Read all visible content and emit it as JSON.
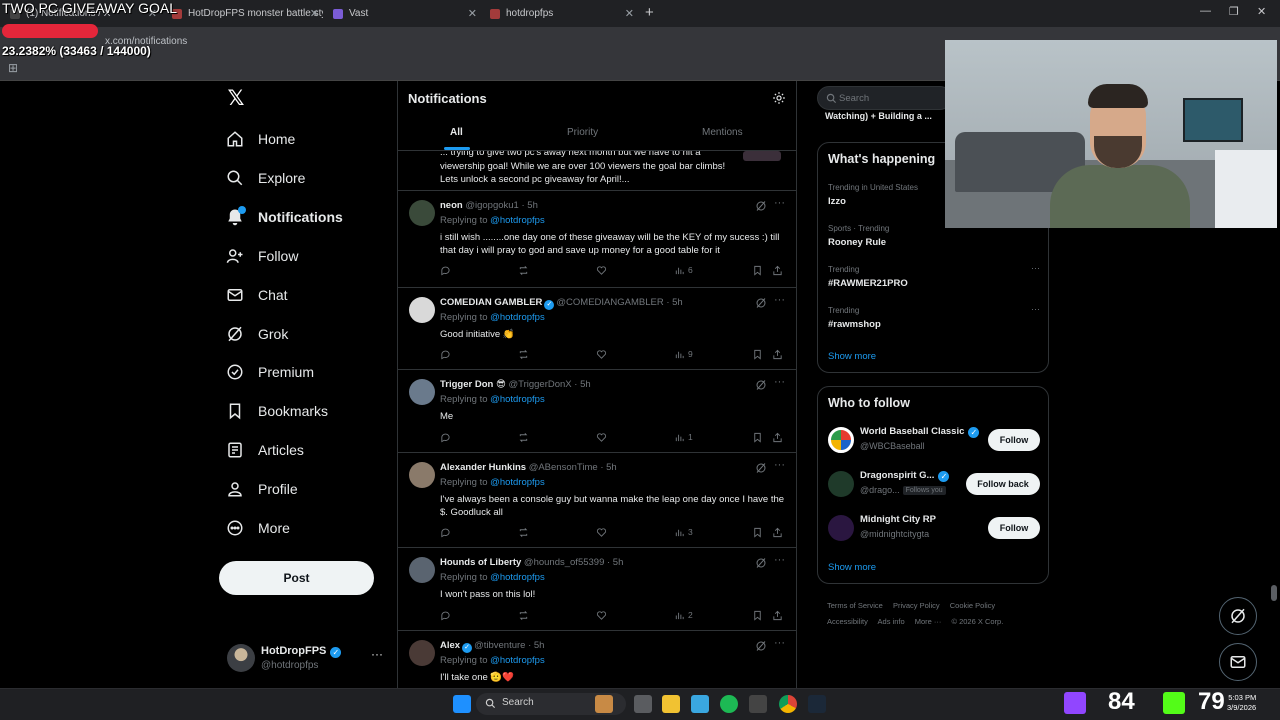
{
  "overlay": {
    "goal_title": "TWO PC GIVEAWAY GOAL",
    "progress_text": "23.2382% (33463 / 144000)",
    "progress_fraction": 0.232
  },
  "browser": {
    "tabs": [
      {
        "title": "(1) Notifications / X",
        "fav_color": "#444444"
      },
      {
        "title": "HotDropFPS monster battle style",
        "fav_color": "#a33b3b"
      },
      {
        "title": "Vast",
        "fav_color": "#7b5cd6"
      },
      {
        "title": "hotdropfps",
        "fav_color": "#a33b3b"
      }
    ],
    "url": "x.com/notifications"
  },
  "nav": {
    "items": [
      {
        "label": "Home",
        "icon": "home-icon"
      },
      {
        "label": "Explore",
        "icon": "search-icon"
      },
      {
        "label": "Notifications",
        "icon": "bell-icon",
        "active": true,
        "badge": "1"
      },
      {
        "label": "Follow",
        "icon": "follow-icon"
      },
      {
        "label": "Chat",
        "icon": "mail-icon"
      },
      {
        "label": "Grok",
        "icon": "grok-icon"
      },
      {
        "label": "Premium",
        "icon": "premium-icon"
      },
      {
        "label": "Bookmarks",
        "icon": "bookmark-icon"
      },
      {
        "label": "Articles",
        "icon": "article-icon"
      },
      {
        "label": "Profile",
        "icon": "profile-icon"
      },
      {
        "label": "More",
        "icon": "more-circle-icon"
      }
    ],
    "post_label": "Post",
    "account": {
      "name": "HotDropFPS",
      "handle": "@hotdropfps"
    }
  },
  "main": {
    "title": "Notifications",
    "tabs": [
      "All",
      "Priority",
      "Mentions"
    ],
    "top_partial_text": "... trying to give two pc's away next month but we have to hit a viewership goal! While we are over 100 viewers the goal bar climbs! Lets unlock a second pc giveaway for April!...",
    "posts": [
      {
        "name": "neon",
        "handle": "@igopgoku1",
        "time": "· 5h",
        "verified": false,
        "replying": "Replying to",
        "mention": "@hotdropfps",
        "text": "i still wish ........one day one of these giveaway will be the KEY of my sucess :) till that day i will pray to god and save up money for a good table for it",
        "views": "6",
        "avatar_color": "#3a4a3a"
      },
      {
        "name": "COMEDIAN GAMBLER",
        "handle": "@COMEDIANGAMBLER",
        "time": "· 5h",
        "verified": true,
        "replying": "Replying to",
        "mention": "@hotdropfps",
        "text": "Good initiative 👏",
        "views": "9",
        "avatar_color": "#d9d9d9"
      },
      {
        "name": "Trigger Don 😎",
        "handle": "@TriggerDonX",
        "time": "· 5h",
        "verified": false,
        "replying": "Replying to",
        "mention": "@hotdropfps",
        "text": "Me",
        "views": "1",
        "avatar_color": "#6a7a8c"
      },
      {
        "name": "Alexander Hunkins",
        "handle": "@ABensonTime",
        "time": "· 5h",
        "verified": false,
        "replying": "Replying to",
        "mention": "@hotdropfps",
        "text": "I've always been a console guy but wanna make the leap one day once I have the $. Goodluck all",
        "views": "3",
        "avatar_color": "#8a7a6a"
      },
      {
        "name": "Hounds of Liberty",
        "handle": "@hounds_of55399",
        "time": "· 5h",
        "verified": false,
        "replying": "Replying to",
        "mention": "@hotdropfps",
        "text": "I won't pass on this lol!",
        "views": "2",
        "avatar_color": "#5a6470"
      },
      {
        "name": "Alex",
        "handle": "@tibventure",
        "time": "· 5h",
        "verified": true,
        "replying": "Replying to",
        "mention": "@hotdropfps",
        "text": "I'll take one 🫡❤️",
        "views": "",
        "avatar_color": "#4a3a36"
      }
    ]
  },
  "right": {
    "search_placeholder": "Search",
    "live_strip": "Watching) + Building a ...",
    "happening": {
      "title": "What's happening",
      "trends": [
        {
          "context": "Trending in United States",
          "name": "Izzo"
        },
        {
          "context": "Sports · Trending",
          "name": "Rooney Rule"
        },
        {
          "context": "Trending",
          "name": "#RAWMER21PRO"
        },
        {
          "context": "Trending",
          "name": "#rawmshop"
        }
      ],
      "show_more": "Show more"
    },
    "who_to_follow": {
      "title": "Who to follow",
      "accounts": [
        {
          "name": "World Baseball Classic",
          "handle": "@WBCBaseball",
          "button": "Follow",
          "follows_you": "",
          "avatar_color": "#ffffff"
        },
        {
          "name": "Dragonspirit G...",
          "handle": "@drago...",
          "button": "Follow back",
          "follows_you": "Follows you",
          "avatar_color": "#1f3a2a"
        },
        {
          "name": "Midnight City RP",
          "handle": "@midnightcitygta",
          "button": "Follow",
          "follows_you": "",
          "avatar_color": "#2a1640"
        }
      ],
      "show_more": "Show more"
    },
    "footer": [
      "Terms of Service",
      "Privacy Policy",
      "Cookie Policy",
      "Accessibility",
      "Ads info",
      "More ···",
      "© 2026 X Corp."
    ]
  },
  "taskbar": {
    "search_label": "Search",
    "stat_1": "84",
    "stat_2": "79",
    "time": "5:03 PM",
    "date": "3/9/2026"
  }
}
